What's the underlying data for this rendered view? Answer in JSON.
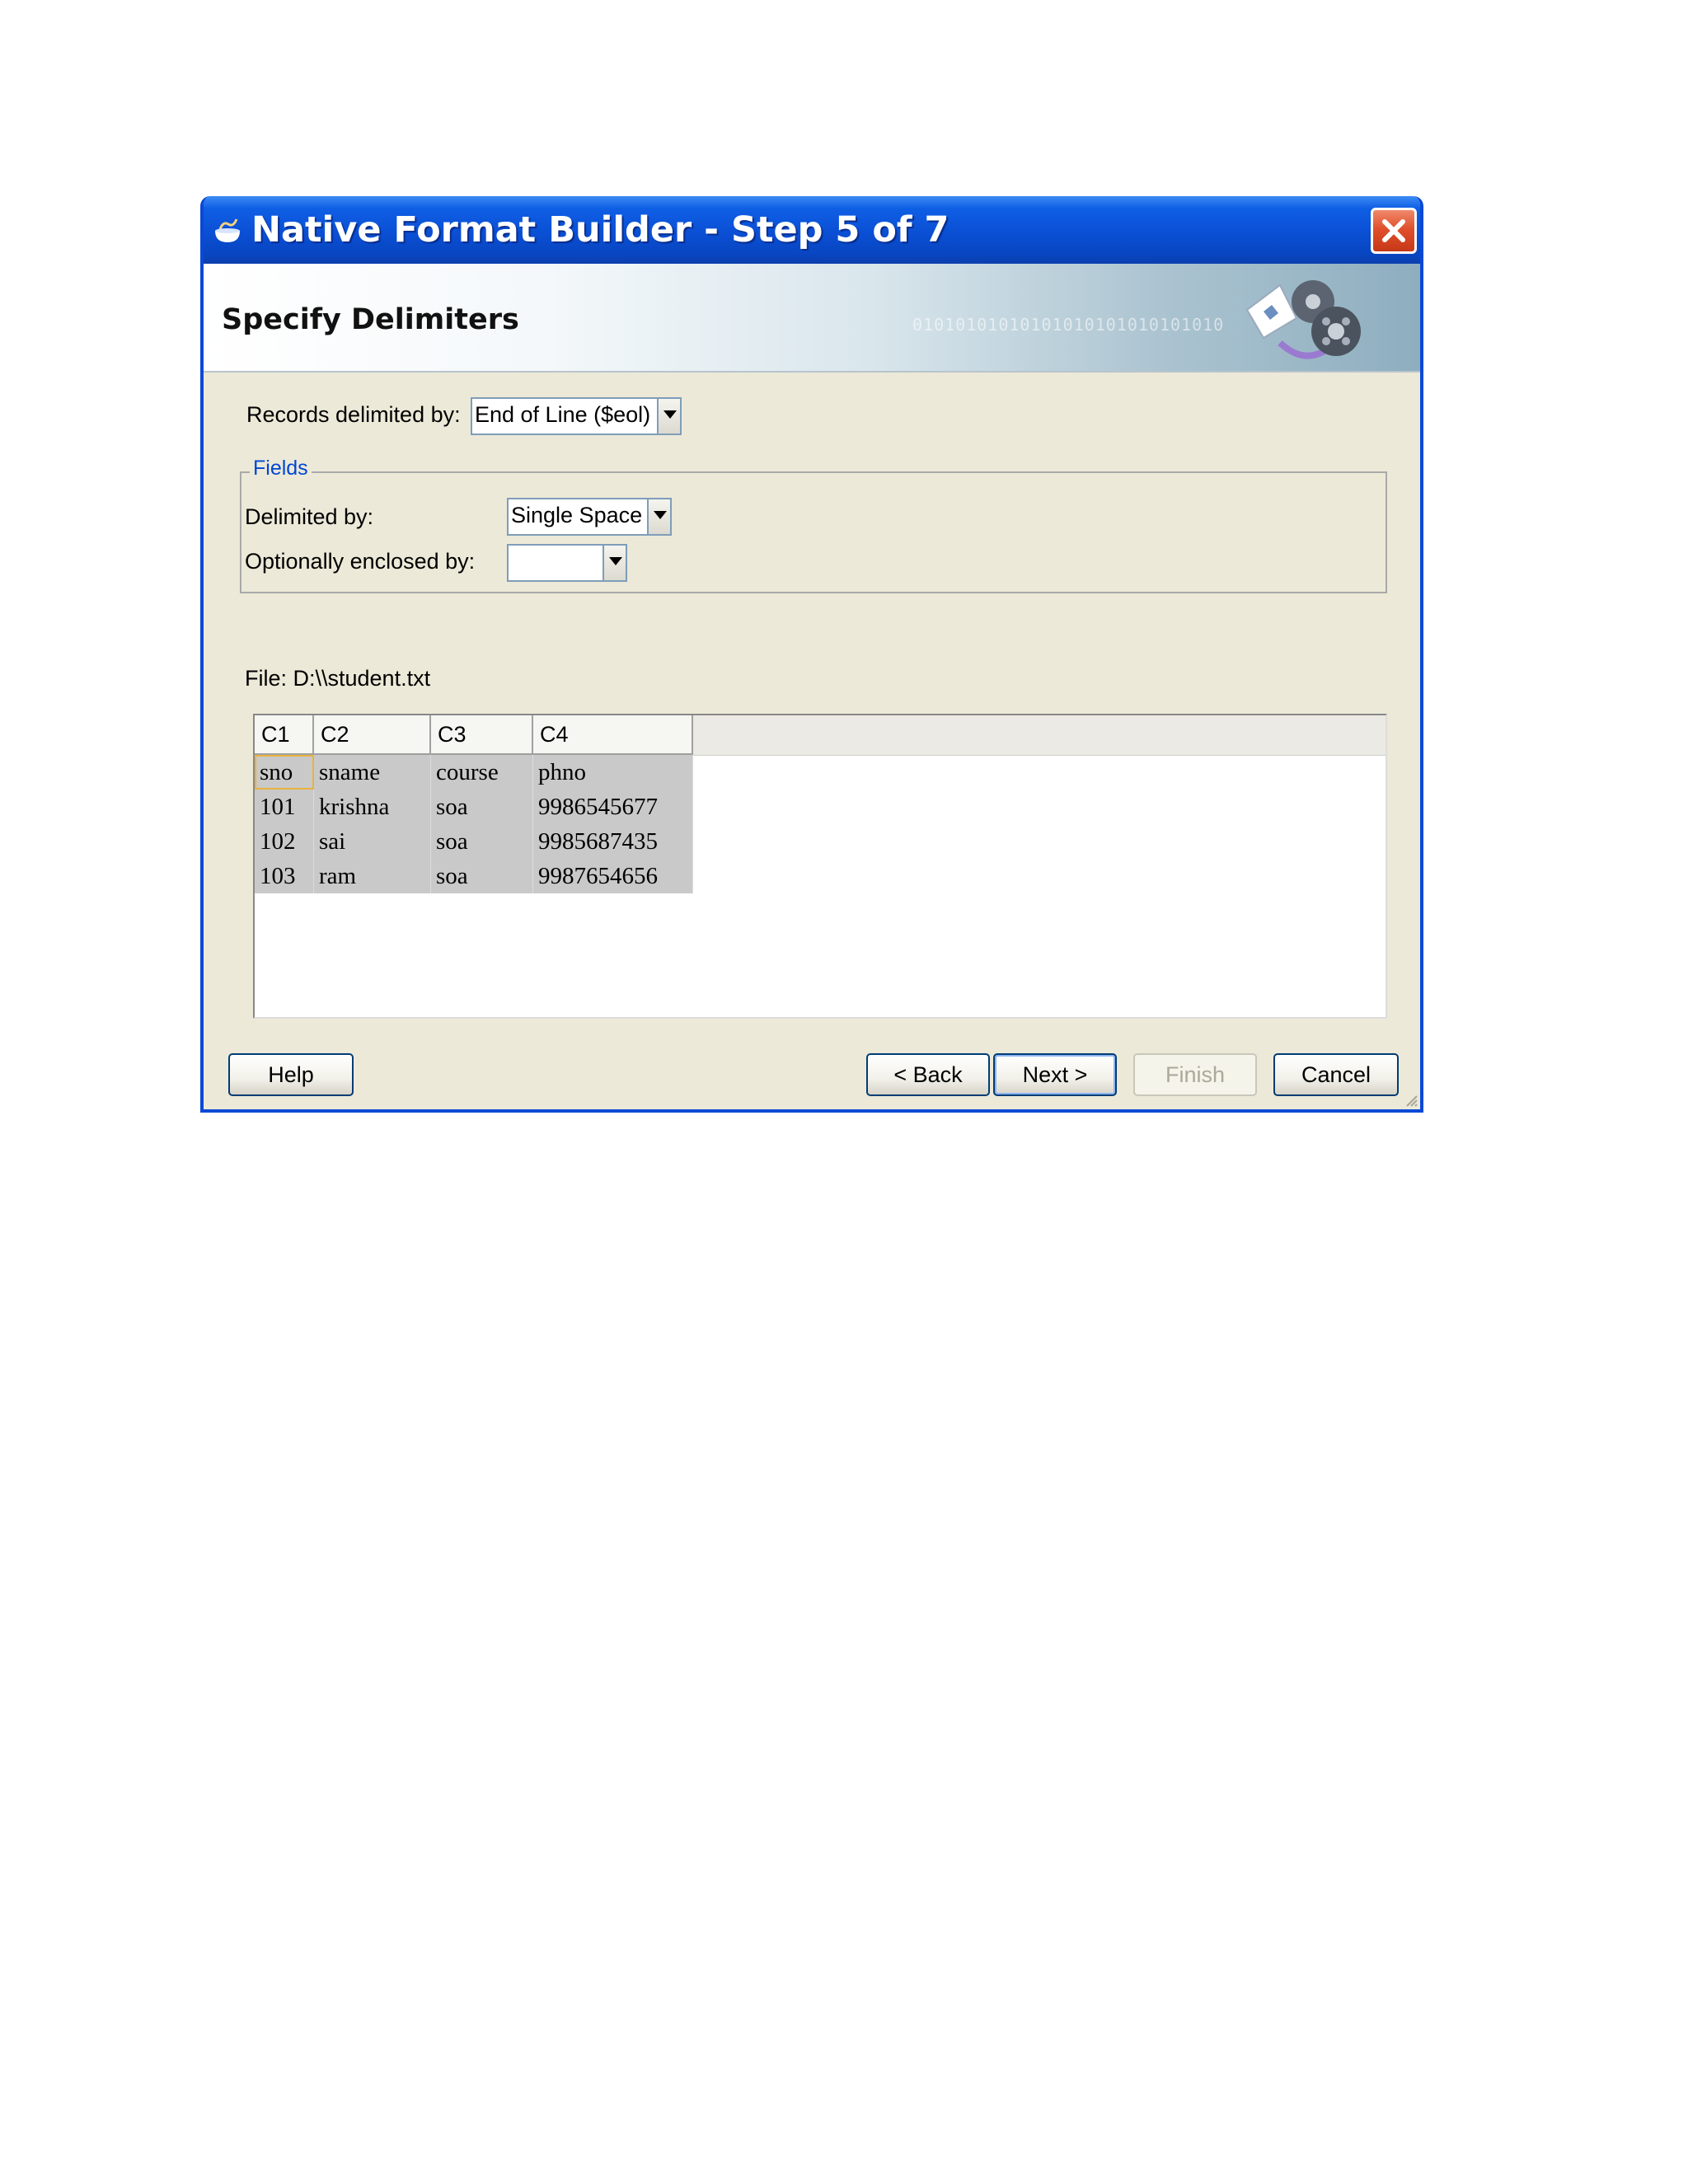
{
  "window": {
    "title": "Native Format Builder - Step 5 of 7"
  },
  "header": {
    "title": "Specify Delimiters",
    "binary_text": "01010101010101010101010101010"
  },
  "records": {
    "label": "Records delimited by:",
    "value": "End of Line ($eol)"
  },
  "fields": {
    "legend": "Fields",
    "delimited_label": "Delimited by:",
    "delimited_value": "Single Space",
    "enclosed_label": "Optionally enclosed by:",
    "enclosed_value": ""
  },
  "file": {
    "label": "File: D:\\\\student.txt"
  },
  "table": {
    "columns": [
      "C1",
      "C2",
      "C3",
      "C4"
    ],
    "rows": [
      [
        "sno",
        "sname",
        "course",
        "phno"
      ],
      [
        "101",
        "krishna",
        "soa",
        "9986545677"
      ],
      [
        "102",
        "sai",
        "soa",
        "9985687435"
      ],
      [
        "103",
        "ram",
        "soa",
        "9987654656"
      ]
    ]
  },
  "buttons": {
    "help": "Help",
    "back": "< Back",
    "next": "Next >",
    "finish": "Finish",
    "cancel": "Cancel"
  },
  "colors": {
    "titlebar": "#0a4fd4",
    "close": "#e0502c",
    "dialog_bg": "#ece9d8",
    "cell_bg": "#c9c9c9"
  }
}
